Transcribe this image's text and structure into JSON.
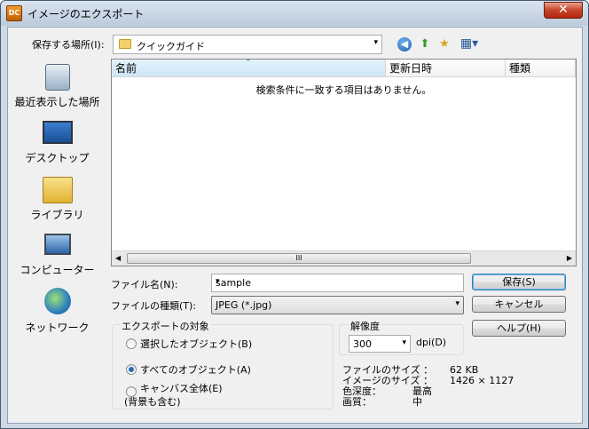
{
  "window": {
    "icon_text": "DC",
    "title": "イメージのエクスポート",
    "close_glyph": "✕"
  },
  "toolbar": {
    "save_in_label": "保存する場所(I):",
    "current_folder": "クイックガイド",
    "combo_arrow": "▾",
    "back_glyph": "◀",
    "up_glyph": "⬆",
    "newfolder_glyph": "★",
    "view_glyph": "▦▾"
  },
  "places": [
    {
      "label": "最近表示した場所",
      "icon": "recent-places-icon"
    },
    {
      "label": "デスクトップ",
      "icon": "desktop-icon"
    },
    {
      "label": "ライブラリ",
      "icon": "libraries-icon"
    },
    {
      "label": "コンピューター",
      "icon": "computer-icon"
    },
    {
      "label": "ネットワーク",
      "icon": "network-icon"
    }
  ],
  "filelist": {
    "columns": [
      "名前",
      "更新日時",
      "種類"
    ],
    "sort_glyph": "⌃",
    "empty_message": "検索条件に一致する項目はありません。",
    "scroll_left": "◀",
    "scroll_right": "▶",
    "scroll_thumb": "III"
  },
  "form": {
    "filename_label": "ファイル名(N):",
    "filename_value": "sample",
    "filetype_label": "ファイルの種類(T):",
    "filetype_value": "JPEG (*.jpg)"
  },
  "buttons": {
    "save": "保存(S)",
    "cancel": "キャンセル",
    "help": "ヘルプ(H)"
  },
  "export_target": {
    "title": "エクスポートの対象",
    "options": [
      {
        "label": "選択したオブジェクト(B)",
        "selected": false
      },
      {
        "label": "すべてのオブジェクト(A)",
        "selected": true
      },
      {
        "label": "キャンバス全体(E)",
        "label2": "(背景も含む)",
        "selected": false
      }
    ]
  },
  "resolution": {
    "title": "解像度",
    "value": "300",
    "unit": "dpi(D)"
  },
  "info": {
    "file_size_label": "ファイルのサイズ ：",
    "file_size_value": "62 KB",
    "image_size_label": "イメージのサイズ ：",
    "image_size_value": "1426 × 1127",
    "color_depth_label": "色深度：",
    "color_depth_value": "最高",
    "quality_label": "画質：",
    "quality_value": "中"
  }
}
